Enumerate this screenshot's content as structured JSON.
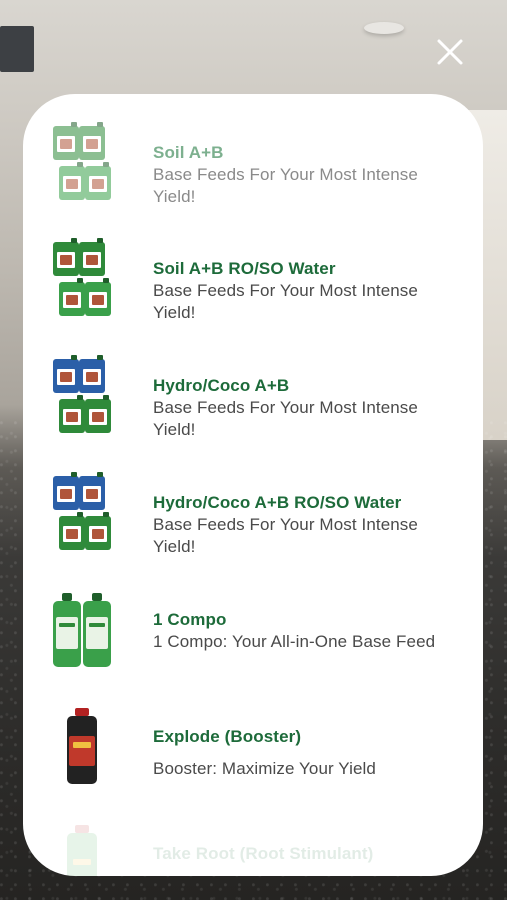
{
  "close": {
    "icon": "close-icon"
  },
  "products": [
    {
      "title": "Soil A+B",
      "desc": "Base Feeds For Your Most Intense Yield!",
      "thumb": "quad",
      "colors": [
        "#2f8a3a",
        "#3aa04a"
      ]
    },
    {
      "title": "Soil A+B RO/SO Water",
      "desc": "Base Feeds For Your Most Intense Yield!",
      "thumb": "quad",
      "colors": [
        "#2f8a3a",
        "#3aa04a"
      ]
    },
    {
      "title": "Hydro/Coco A+B",
      "desc": "Base Feeds For Your Most Intense Yield!",
      "thumb": "quad",
      "colors": [
        "#2b5fa8",
        "#2f8a3a"
      ]
    },
    {
      "title": "Hydro/Coco A+B RO/SO Water",
      "desc": "Base Feeds For Your Most Intense Yield!",
      "thumb": "quad",
      "colors": [
        "#2b5fa8",
        "#2f8a3a"
      ]
    },
    {
      "title": "1 Compo",
      "desc": "1 Compo: Your All-in-One Base Feed",
      "thumb": "pair",
      "colors": [
        "#3aa04a",
        "#3aa04a"
      ]
    },
    {
      "title": "Explode (Booster)",
      "desc": "Booster: Maximize Your Yield",
      "thumb": "single",
      "colors": [
        "#222222",
        "#c0392b"
      ]
    },
    {
      "title": "Take Root (Root Stimulant)",
      "desc": "",
      "thumb": "single",
      "colors": [
        "#3aa04a",
        "#3aa04a"
      ]
    }
  ]
}
